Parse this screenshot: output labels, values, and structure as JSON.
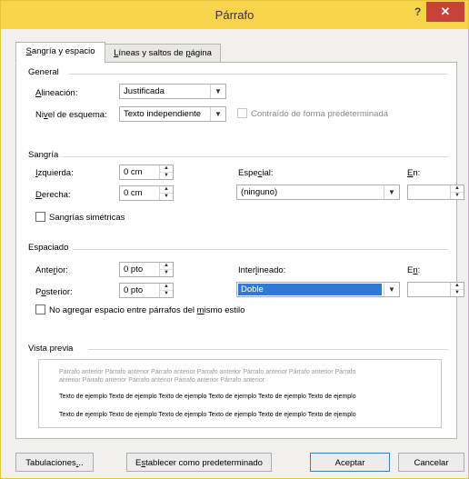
{
  "window": {
    "title": "Párrafo",
    "help_label": "?",
    "close_label": "✕"
  },
  "tabs": [
    {
      "label_pre": "",
      "label_u": "S",
      "label_post": "angría y espacio"
    },
    {
      "label_pre": "",
      "label_u": "L",
      "label_post": "íneas y saltos de ",
      "label_u2": "p",
      "label_post2": "ágina"
    }
  ],
  "general": {
    "heading": "General",
    "alignment_label_u": "A",
    "alignment_label_rest": "lineación:",
    "alignment_value": "Justificada",
    "outline_label_pre": "Ni",
    "outline_label_u": "v",
    "outline_label_rest": "el de esquema:",
    "outline_value": "Texto independiente",
    "collapsed_label": "Contraído de forma predeterminada"
  },
  "indent": {
    "heading": "Sangría",
    "left_label_u": "I",
    "left_label_rest": "zquierda:",
    "left_value": "0 cm",
    "right_label_u": "D",
    "right_label_rest": "erecha:",
    "right_value": "0 cm",
    "special_label_pre": "Espe",
    "special_label_u": "c",
    "special_label_rest": "ial:",
    "special_value": "(ninguno)",
    "by_label_u": "E",
    "by_label_rest": "n:",
    "mirror_label_pre": "San",
    "mirror_label_u": "g",
    "mirror_label_rest": "rías simétricas"
  },
  "spacing": {
    "heading": "Espaciado",
    "before_label_pre": "Ante",
    "before_label_u": "r",
    "before_label_rest": "ior:",
    "before_value": "0 pto",
    "after_label_pre": "P",
    "after_label_u": "o",
    "after_label_rest": "sterior:",
    "after_value": "0 pto",
    "line_label_pre": "Inter",
    "line_label_u": "l",
    "line_label_rest": "ineado:",
    "line_value": "Doble",
    "at_label_pre": "E",
    "at_label_u": "n",
    "at_label_rest": ":",
    "no_space_pre": "No agregar espacio entre párrafos del ",
    "no_space_u": "m",
    "no_space_rest": "ismo estilo"
  },
  "preview": {
    "heading": "Vista previa",
    "prev_line1": "Párrafo anterior Párrafo anterior Párrafo anterior Párrafo anterior Párrafo anterior Párrafo anterior Párrafo",
    "prev_line2": "anterior Párrafo anterior Párrafo anterior Párrafo anterior Párrafo anterior",
    "sample_line1": "Texto de ejemplo Texto de ejemplo Texto de ejemplo Texto de ejemplo Texto de ejemplo Texto de ejemplo",
    "sample_line2": "Texto de ejemplo Texto de ejemplo Texto de ejemplo Texto de ejemplo Texto de ejemplo Texto de ejemplo"
  },
  "buttons": {
    "tabs_pre": "Tabulaciones",
    "tabs_u": ".",
    "tabs_rest": "..",
    "default_pre": "E",
    "default_u": "s",
    "default_rest": "tablecer como predeterminado",
    "ok": "Aceptar",
    "cancel": "Cancelar"
  },
  "colors": {
    "titlebar": "#f8d44c",
    "close": "#c7423b",
    "selected": "#3178d6"
  }
}
